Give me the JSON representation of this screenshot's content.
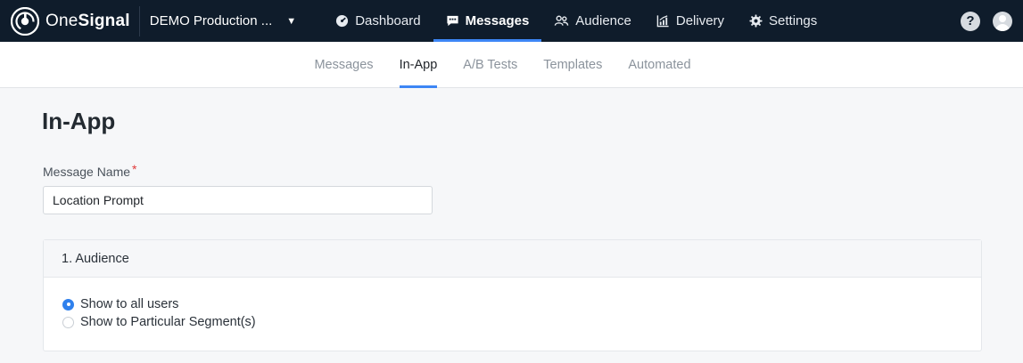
{
  "topbar": {
    "brand": {
      "part1": "One",
      "part2": "Signal"
    },
    "app_selector": {
      "label": "DEMO Production ...",
      "caret": "▼"
    },
    "nav": [
      {
        "label": "Dashboard",
        "icon": "dashboard-icon",
        "active": false
      },
      {
        "label": "Messages",
        "icon": "messages-icon",
        "active": true
      },
      {
        "label": "Audience",
        "icon": "audience-icon",
        "active": false
      },
      {
        "label": "Delivery",
        "icon": "delivery-icon",
        "active": false
      },
      {
        "label": "Settings",
        "icon": "gear-icon",
        "active": false
      }
    ],
    "help": "?"
  },
  "subnav": {
    "tabs": [
      {
        "label": "Messages",
        "active": false
      },
      {
        "label": "In-App",
        "active": true
      },
      {
        "label": "A/B Tests",
        "active": false
      },
      {
        "label": "Templates",
        "active": false
      },
      {
        "label": "Automated",
        "active": false
      }
    ]
  },
  "main": {
    "title": "In-App",
    "message_name": {
      "label": "Message Name",
      "required_mark": "*",
      "value": "Location Prompt"
    },
    "audience_card": {
      "header": "1. Audience",
      "options": [
        {
          "label": "Show to all users",
          "checked": true
        },
        {
          "label": "Show to Particular Segment(s)",
          "checked": false
        }
      ]
    }
  },
  "colors": {
    "topbar_bg": "#0f1c2b",
    "accent": "#3d86f5",
    "radio_selected": "#2f80ed",
    "required": "#e03a3a"
  }
}
